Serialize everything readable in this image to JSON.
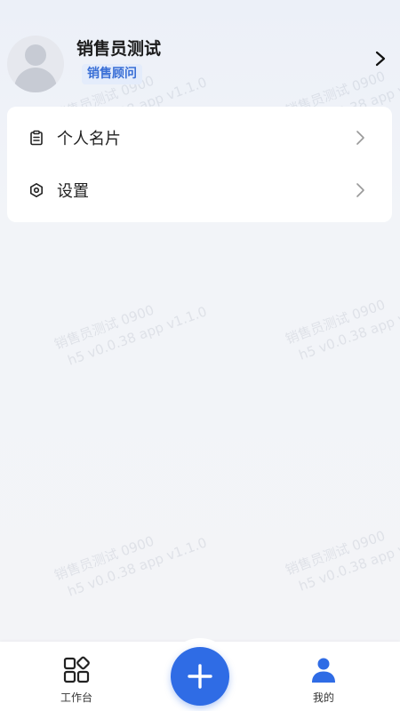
{
  "profile": {
    "name": "销售员测试",
    "role": "销售顾问"
  },
  "menu": {
    "items": [
      {
        "label": "个人名片",
        "icon": "clipboard-icon"
      },
      {
        "label": "设置",
        "icon": "settings-hexagon-icon"
      }
    ]
  },
  "watermark": {
    "line1": "销售员测试 0900",
    "line2": "h5 v0.0.38 app v1.1.0"
  },
  "tabbar": {
    "workbench_label": "工作台",
    "mine_label": "我的",
    "add_icon": "plus-icon"
  },
  "colors": {
    "accent": "#2f6ce5",
    "badge_bg": "#e4ecfb",
    "badge_text": "#3a6fd6"
  }
}
